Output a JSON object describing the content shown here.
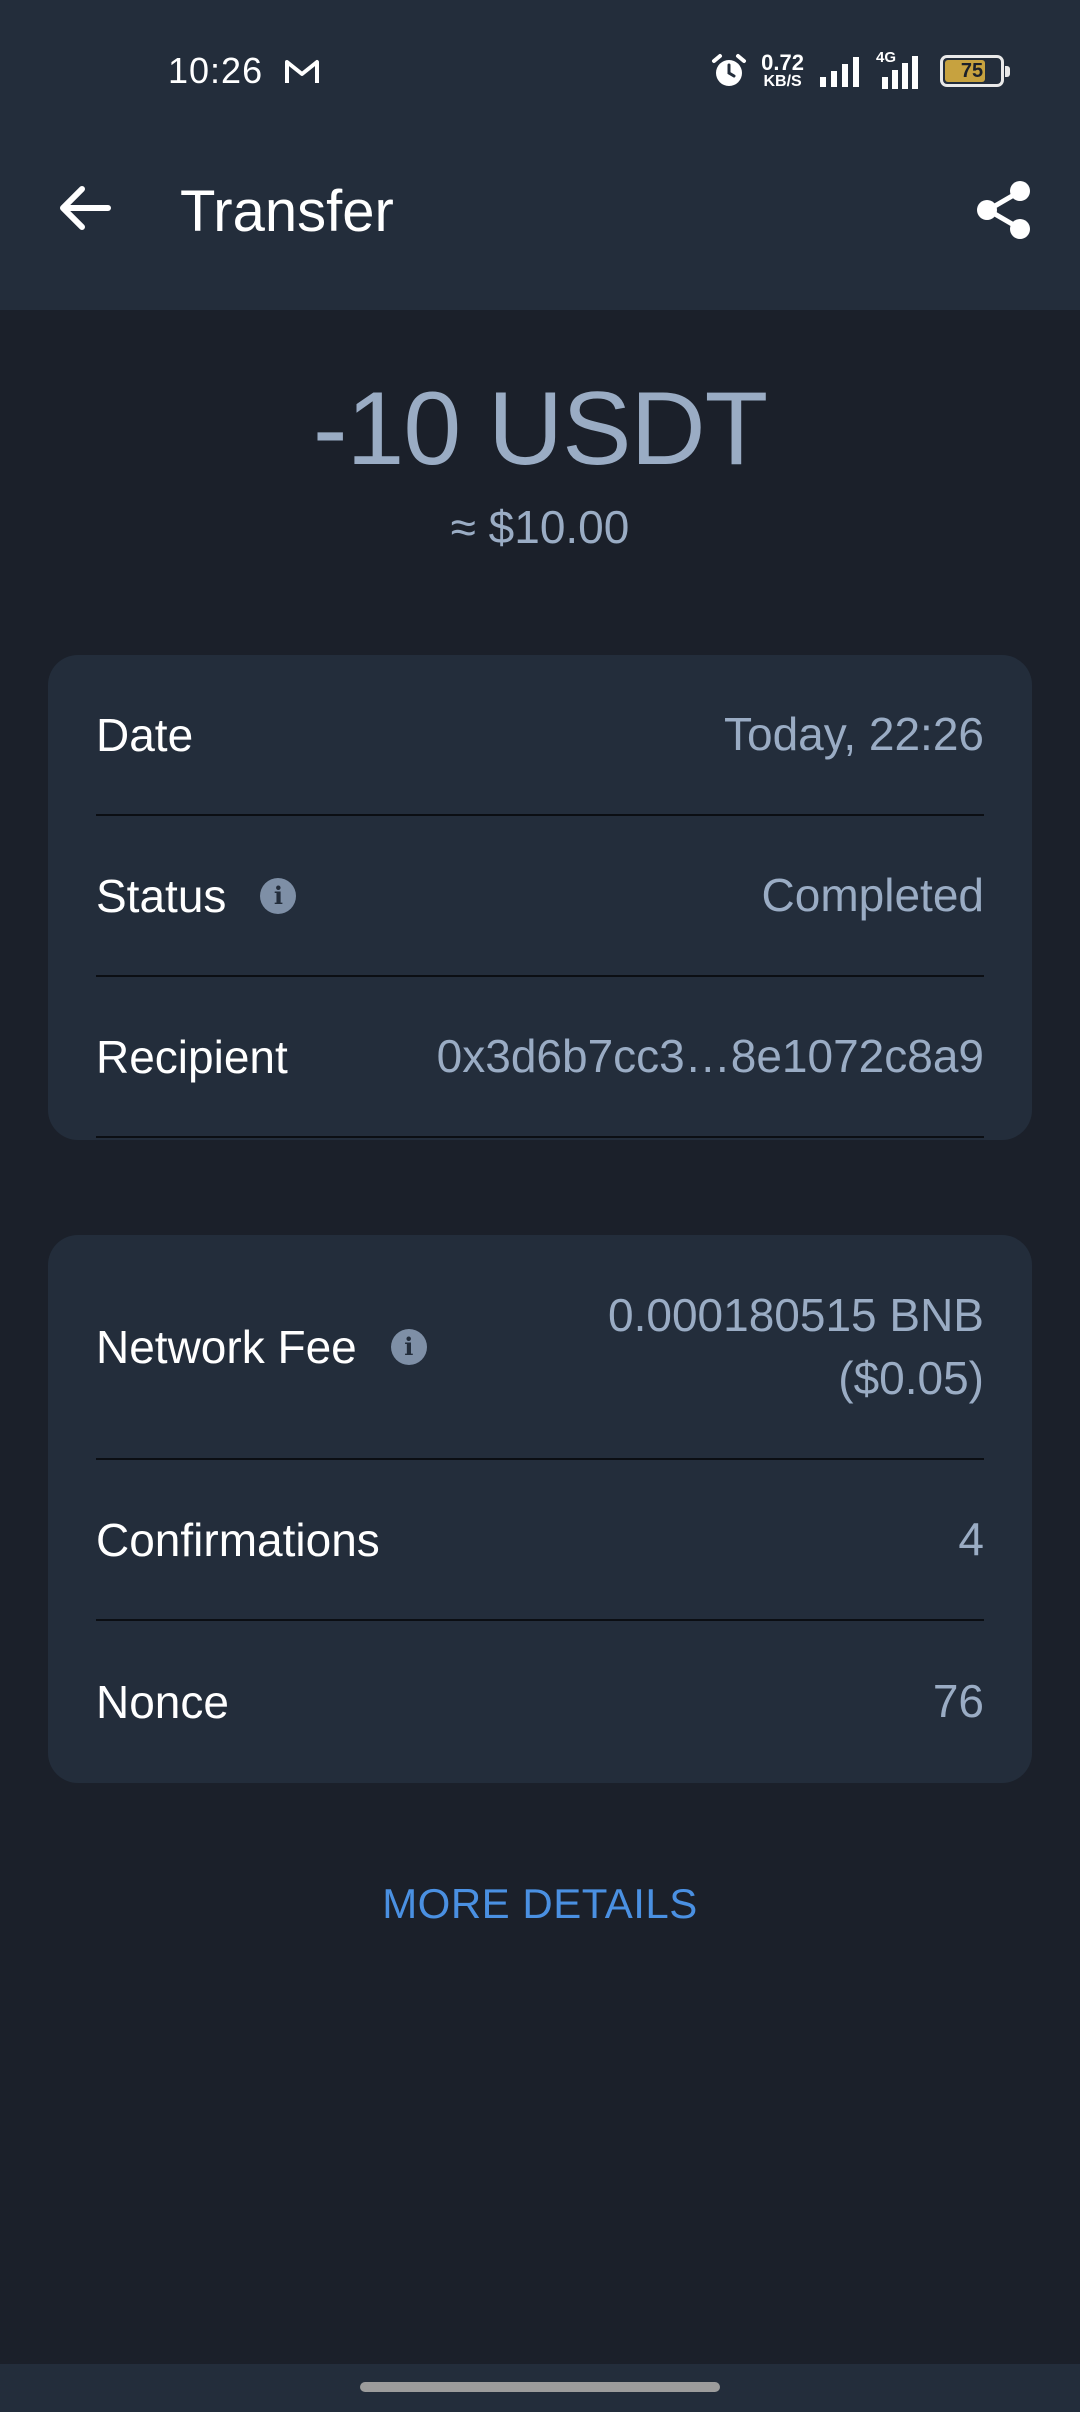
{
  "status_bar": {
    "time": "10:26",
    "net_speed_value": "0.72",
    "net_speed_unit": "KB/S",
    "network_type": "4G",
    "battery": "75",
    "battery_level": 0.75
  },
  "app_bar": {
    "title": "Transfer"
  },
  "transaction": {
    "amount": "-10 USDT",
    "fiat": "≈ $10.00"
  },
  "details_card": {
    "date_label": "Date",
    "date_value": "Today, 22:26",
    "status_label": "Status",
    "status_value": "Completed",
    "recipient_label": "Recipient",
    "recipient_value": "0x3d6b7cc3…8e1072c8a9"
  },
  "fee_card": {
    "fee_label": "Network Fee",
    "fee_value_line1": "0.000180515 BNB",
    "fee_value_line2": "($0.05)",
    "confirmations_label": "Confirmations",
    "confirmations_value": "4",
    "nonce_label": "Nonce",
    "nonce_value": "76"
  },
  "more_details_label": "MORE DETAILS",
  "colors": {
    "background": "#1b202a",
    "card": "#232d3b",
    "muted_text": "#9aacc4",
    "link": "#4a90e2"
  }
}
